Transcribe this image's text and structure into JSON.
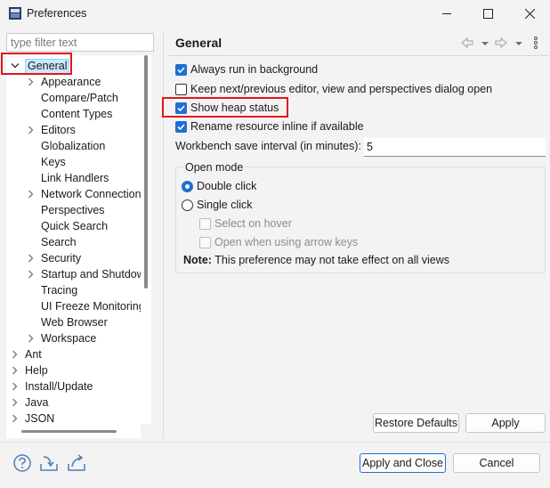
{
  "window": {
    "title": "Preferences"
  },
  "filter": {
    "placeholder": "type filter text"
  },
  "tree": [
    {
      "label": "General",
      "level": 0,
      "expanded": true,
      "hasChildren": true,
      "selected": true
    },
    {
      "label": "Appearance",
      "level": 1,
      "hasChildren": true
    },
    {
      "label": "Compare/Patch",
      "level": 1,
      "hasChildren": false
    },
    {
      "label": "Content Types",
      "level": 1,
      "hasChildren": false
    },
    {
      "label": "Editors",
      "level": 1,
      "hasChildren": true
    },
    {
      "label": "Globalization",
      "level": 1,
      "hasChildren": false
    },
    {
      "label": "Keys",
      "level": 1,
      "hasChildren": false
    },
    {
      "label": "Link Handlers",
      "level": 1,
      "hasChildren": false
    },
    {
      "label": "Network Connections",
      "level": 1,
      "hasChildren": true
    },
    {
      "label": "Perspectives",
      "level": 1,
      "hasChildren": false
    },
    {
      "label": "Quick Search",
      "level": 1,
      "hasChildren": false
    },
    {
      "label": "Search",
      "level": 1,
      "hasChildren": false
    },
    {
      "label": "Security",
      "level": 1,
      "hasChildren": true
    },
    {
      "label": "Startup and Shutdown",
      "level": 1,
      "hasChildren": true
    },
    {
      "label": "Tracing",
      "level": 1,
      "hasChildren": false
    },
    {
      "label": "UI Freeze Monitoring",
      "level": 1,
      "hasChildren": false
    },
    {
      "label": "Web Browser",
      "level": 1,
      "hasChildren": false
    },
    {
      "label": "Workspace",
      "level": 1,
      "hasChildren": true
    },
    {
      "label": "Ant",
      "level": 0,
      "hasChildren": true
    },
    {
      "label": "Help",
      "level": 0,
      "hasChildren": true
    },
    {
      "label": "Install/Update",
      "level": 0,
      "hasChildren": true
    },
    {
      "label": "Java",
      "level": 0,
      "hasChildren": true
    },
    {
      "label": "JSON",
      "level": 0,
      "hasChildren": true
    }
  ],
  "general": {
    "title": "General",
    "options": [
      {
        "label": "Always run in background",
        "checked": true
      },
      {
        "label": "Keep next/previous editor, view and perspectives dialog open",
        "checked": false
      },
      {
        "label": "Show heap status",
        "checked": true
      },
      {
        "label": "Rename resource inline if available",
        "checked": true
      }
    ],
    "interval_label": "Workbench save interval (in minutes):",
    "interval_value": "5",
    "open_mode": {
      "label": "Open mode",
      "double_click": "Double click",
      "single_click": "Single click",
      "select_on_hover": "Select on hover",
      "open_arrow_keys": "Open when using arrow keys",
      "selected": "double"
    },
    "note_bold": "Note:",
    "note_text": " This preference may not take effect on all views"
  },
  "buttons": {
    "restore_defaults": "Restore Defaults",
    "apply": "Apply",
    "apply_and_close": "Apply and Close",
    "cancel": "Cancel"
  },
  "icons": [
    "help-icon",
    "import-icon",
    "export-icon",
    "back-icon",
    "forward-icon",
    "view-menu-icon"
  ],
  "colors": {
    "accent": "#1f6fd1",
    "highlight": "#e2151e",
    "selection": "#cce8ff"
  }
}
